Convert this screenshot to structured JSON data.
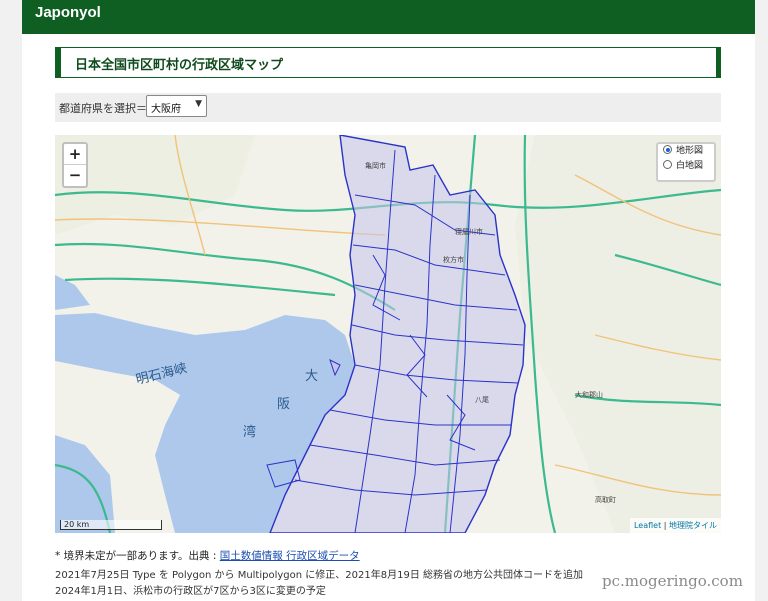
{
  "site": {
    "brand": "Japonyol"
  },
  "heading": {
    "title": "日本全国市区町村の行政区域マップ"
  },
  "selector": {
    "label": "都道府県を選択＝",
    "value": "大阪府",
    "arrow_icon": "chevron-down-icon"
  },
  "map": {
    "zoom_in": "+",
    "zoom_out": "−",
    "layers": [
      {
        "label": "地形図",
        "selected": true
      },
      {
        "label": "白地図",
        "selected": false
      }
    ],
    "scale": "20 km",
    "attribution": {
      "leaflet": "Leaflet",
      "sep": " | ",
      "tiles": "地理院タイル"
    },
    "sea_labels": [
      "明石海峡",
      "大",
      "阪",
      "湾"
    ],
    "place_labels": [
      "亀岡市",
      "枚方市",
      "八尾",
      "大和郡山",
      "高取町",
      "寝屋川市"
    ],
    "colors": {
      "water": "#aec8ec",
      "boundary": "#2a33c8",
      "region_fill": "#c6c4ec",
      "road": "#3cb98e",
      "highway": "#f1c27a",
      "land": "#f2f2ea"
    }
  },
  "notes": {
    "line1_prefix": "* 境界未定が一部あります。出典 :",
    "line1_link": "国土数値情報 行政区域データ",
    "line2": "2021年7月25日 Type を Polygon から Multipolygon に修正、2021年8月19日 総務省の地方公共団体コードを追加",
    "line3": "2024年1月1日、浜松市の行政区が7区から3区に変更の予定"
  },
  "watermark": "pc.mogeringo.com"
}
